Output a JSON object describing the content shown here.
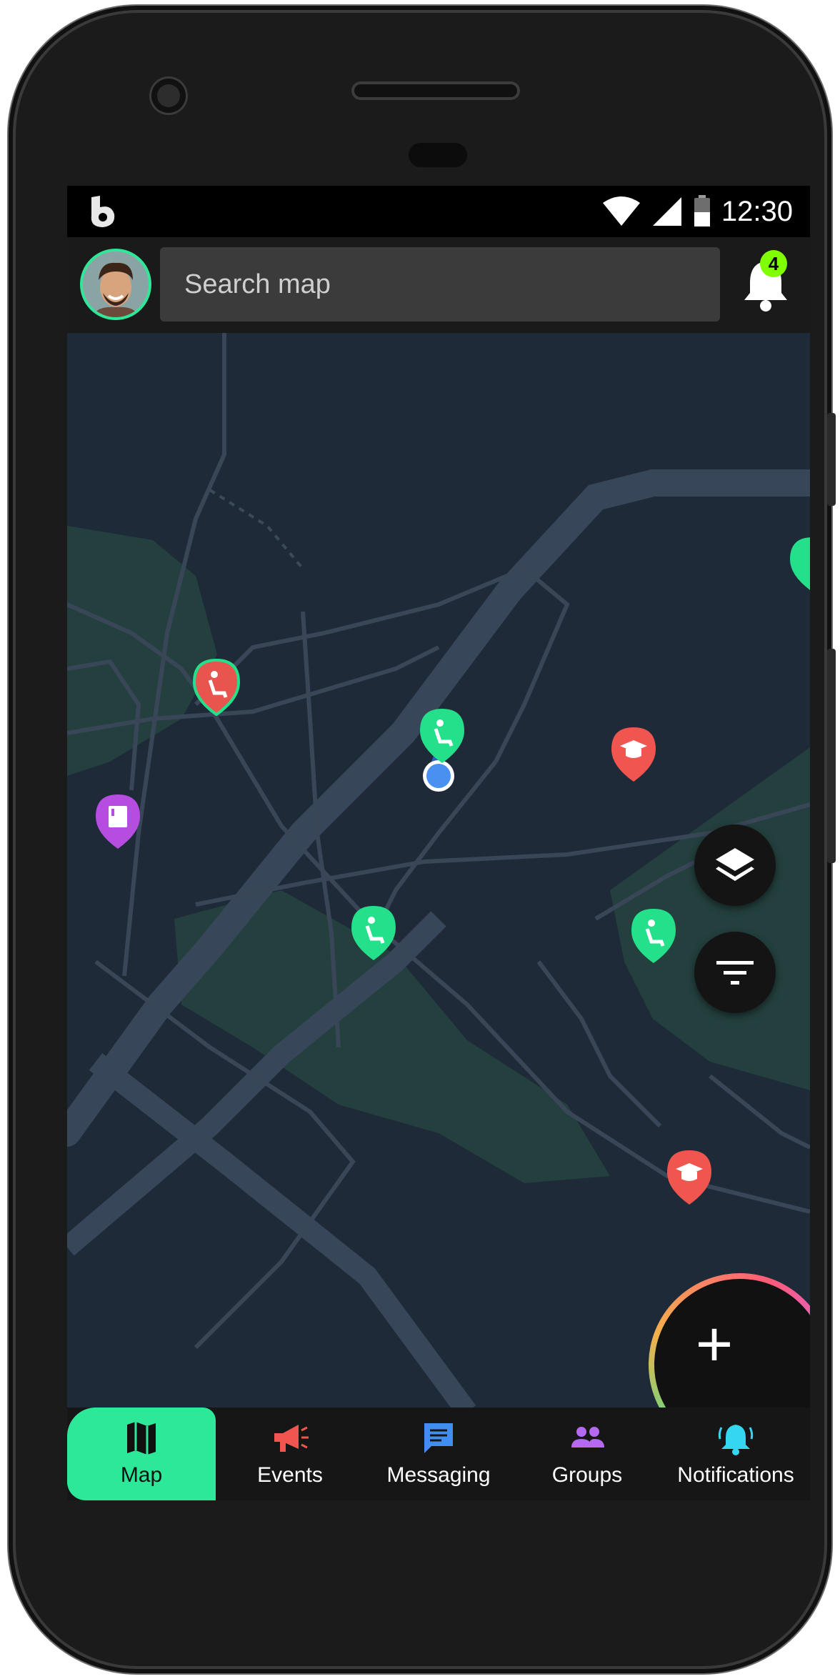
{
  "status_bar": {
    "time": "12:30"
  },
  "app_bar": {
    "search_placeholder": "Search map",
    "notification_count": "4"
  },
  "map": {
    "pins": [
      {
        "type": "accessible",
        "color": "#e8554e"
      },
      {
        "type": "accessible",
        "color": "#24e08a"
      },
      {
        "type": "school",
        "color": "#f0564f"
      },
      {
        "type": "book",
        "color": "#b54ee0"
      },
      {
        "type": "accessible",
        "color": "#24e08a"
      },
      {
        "type": "accessible",
        "color": "#24e08a"
      },
      {
        "type": "school",
        "color": "#f0564f"
      },
      {
        "type": "accessible",
        "color": "#24e08a"
      }
    ],
    "controls": {
      "layers_icon": "layers-icon",
      "filter_icon": "filter-icon",
      "add_label": "+"
    }
  },
  "bottom_nav": {
    "tabs": [
      {
        "label": "Map",
        "icon": "map-icon",
        "color": "#101010",
        "active": true
      },
      {
        "label": "Events",
        "icon": "megaphone-icon",
        "color": "#f0564f",
        "active": false
      },
      {
        "label": "Messaging",
        "icon": "message-icon",
        "color": "#3f8ef0",
        "active": false
      },
      {
        "label": "Groups",
        "icon": "groups-icon",
        "color": "#b469f0",
        "active": false
      },
      {
        "label": "Notifications",
        "icon": "bell-icon",
        "color": "#35d6f0",
        "active": false
      }
    ]
  },
  "colors": {
    "accent": "#2ee89a",
    "map_bg": "#1f2a38",
    "park": "#23403e",
    "road": "#38465a"
  }
}
